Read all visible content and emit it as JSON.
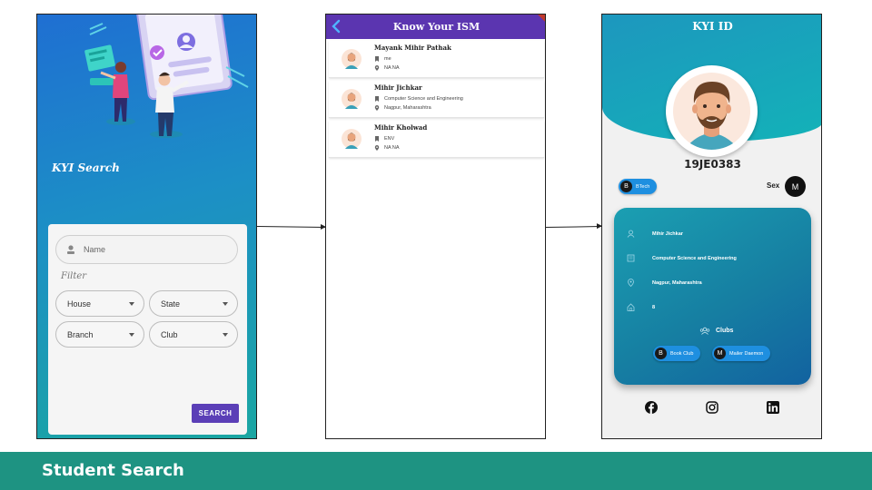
{
  "footer": {
    "title": "Student Search"
  },
  "search_screen": {
    "app_label": "KYI Search",
    "name_placeholder": "Name",
    "filter_label": "Filter",
    "dropdowns": [
      "House",
      "State",
      "Branch",
      "Club"
    ],
    "search_button": "SEARCH",
    "button_color": "#5b3fb7"
  },
  "results_screen": {
    "title": "Know Your ISM",
    "appbar_color": "#5b35b0",
    "results": [
      {
        "name": "Mayank Mihir Pathak",
        "branch": "me",
        "location": "NA  NA"
      },
      {
        "name": "Mihir Jichkar",
        "branch": "Computer Science and Engineering",
        "location": "Nagpur,  Maharashtra"
      },
      {
        "name": "Mihir Kholwad",
        "branch": "ENV",
        "location": "NA  NA"
      }
    ]
  },
  "id_screen": {
    "title": "KYI ID",
    "roll_number": "19JE0383",
    "course_chip": {
      "initial": "B",
      "label": "BTech"
    },
    "sex_label": "Sex",
    "sex_value": "M",
    "details": {
      "name": "Mihir Jichkar",
      "branch": "Computer Science and Engineering",
      "location": "Nagpur,  Maharashtra",
      "house": "8"
    },
    "clubs_label": "Clubs",
    "clubs": [
      {
        "initial": "B",
        "label": "Book Club"
      },
      {
        "initial": "M",
        "label": "Mailer Daemon"
      }
    ],
    "social_icons": [
      "facebook-icon",
      "instagram-icon",
      "linkedin-icon"
    ]
  }
}
